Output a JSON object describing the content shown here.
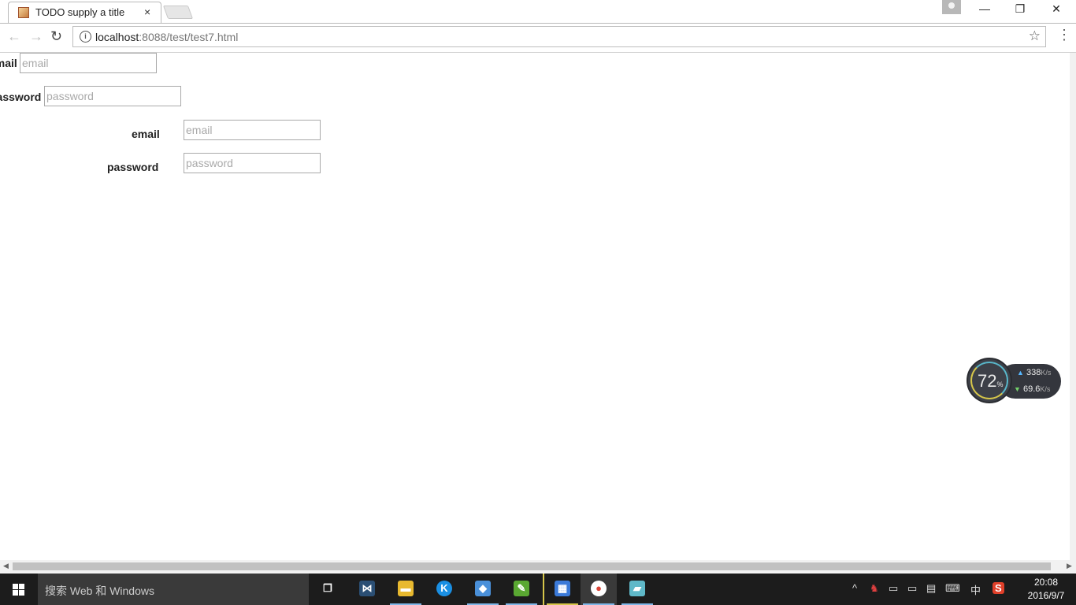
{
  "browser": {
    "tab_title": "TODO supply a title",
    "tab_close": "×",
    "window_controls": {
      "minimize": "—",
      "restore": "❐",
      "close": "✕"
    },
    "nav": {
      "back": "←",
      "forward": "→",
      "reload": "↻"
    },
    "url_host": "localhost",
    "url_rest": ":8088/test/test7.html",
    "bookmark_star": "☆",
    "menu": "⋮"
  },
  "form1": {
    "email_label": "email",
    "email_placeholder": "email",
    "password_label": "password",
    "password_placeholder": "password"
  },
  "form2": {
    "email_label": "email",
    "email_placeholder": "email",
    "password_label": "password",
    "password_placeholder": "password"
  },
  "widget": {
    "percent": "72",
    "percent_unit": "%",
    "upload_value": "338",
    "upload_unit": "K/s",
    "download_value": "69.6",
    "download_unit": "K/s"
  },
  "taskbar": {
    "search_placeholder": "搜索 Web 和 Windows",
    "apps": [
      {
        "name": "task-view",
        "glyph": "❐",
        "color": "#1c1c1c"
      },
      {
        "name": "visual-studio",
        "glyph": "⋈",
        "color": "#2b4f74"
      },
      {
        "name": "file-explorer",
        "glyph": "▬",
        "color": "#e8b92f"
      },
      {
        "name": "kugou",
        "glyph": "K",
        "color": "#1a8fe3"
      },
      {
        "name": "virtualbox",
        "glyph": "◆",
        "color": "#4a90d9"
      },
      {
        "name": "evernote",
        "glyph": "✎",
        "color": "#5aa832"
      },
      {
        "name": "app-window",
        "glyph": "▦",
        "color": "#3b7ad8"
      },
      {
        "name": "chrome",
        "glyph": "●",
        "color": "#db4437"
      },
      {
        "name": "notes",
        "glyph": "▰",
        "color": "#5fb8c8"
      }
    ],
    "ime": "中",
    "tray_up": "^",
    "time": "20:08",
    "date": "2016/9/7"
  }
}
